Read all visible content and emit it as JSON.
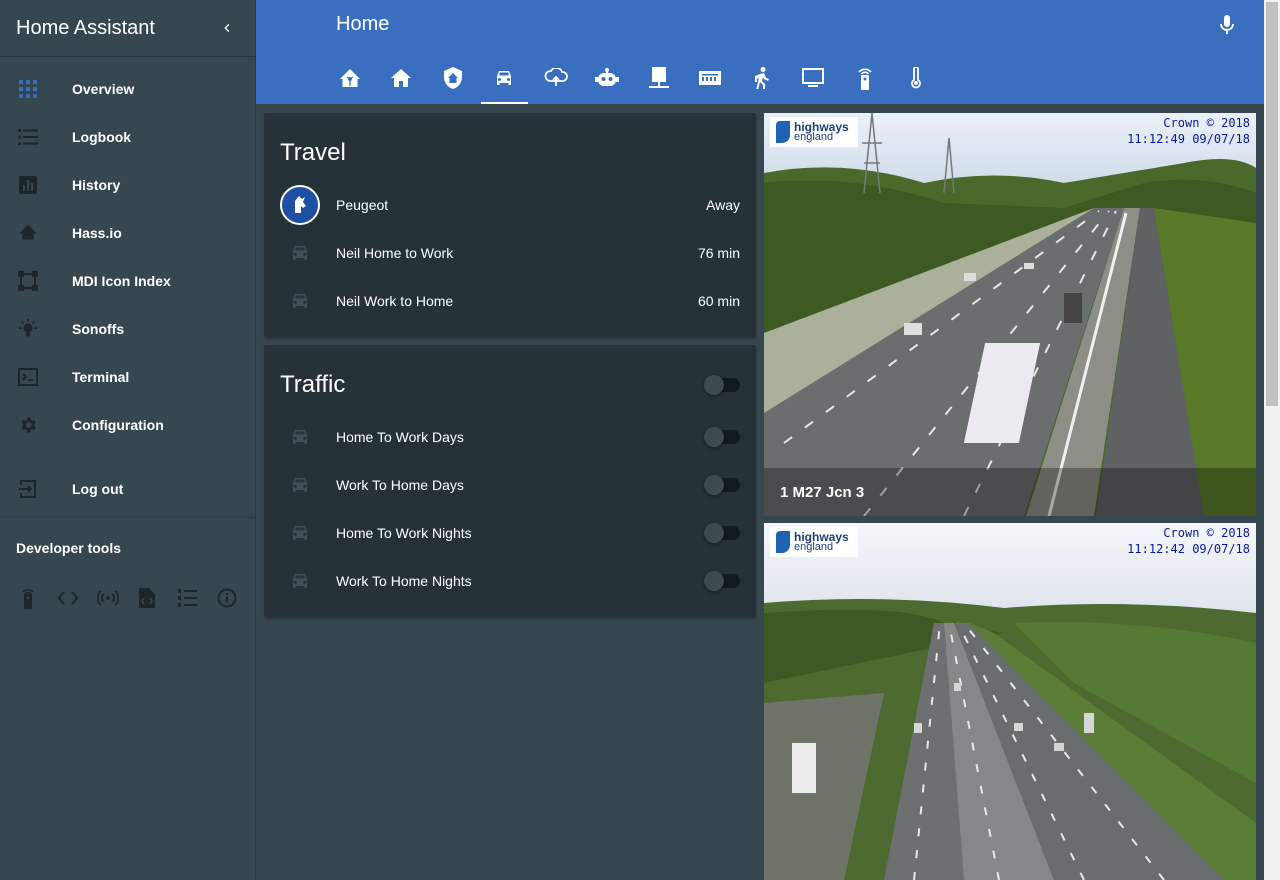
{
  "app": {
    "title": "Home Assistant"
  },
  "sidebar": {
    "items": [
      {
        "label": "Overview",
        "icon": "view-dashboard-icon"
      },
      {
        "label": "Logbook",
        "icon": "format-list-bulleted-icon"
      },
      {
        "label": "History",
        "icon": "chart-box-icon"
      },
      {
        "label": "Hass.io",
        "icon": "home-assistant-icon"
      },
      {
        "label": "MDI Icon Index",
        "icon": "vector-square-icon"
      },
      {
        "label": "Sonoffs",
        "icon": "lightbulb-on-icon"
      },
      {
        "label": "Terminal",
        "icon": "console-icon"
      },
      {
        "label": "Configuration",
        "icon": "settings-icon"
      }
    ],
    "logout": "Log out",
    "dev_tools_title": "Developer tools",
    "dev_tools": [
      "remote-icon",
      "code-tags-icon",
      "access-point-icon",
      "file-xml-icon",
      "format-list-numbers-icon",
      "information-outline-icon"
    ]
  },
  "header": {
    "title": "Home",
    "tabs": [
      "home-assistant-icon",
      "home-icon",
      "shield-home-icon",
      "car-icon",
      "weather-icon",
      "robot-icon",
      "desk-icon",
      "router-icon",
      "walk-icon",
      "monitor-icon",
      "remote-icon",
      "thermometer-icon"
    ],
    "active_tab": 3
  },
  "travel": {
    "title": "Travel",
    "rows": [
      {
        "name": "Peugeot",
        "value": "Away"
      },
      {
        "name": "Neil Home to Work",
        "value": "76 min"
      },
      {
        "name": "Neil Work to Home",
        "value": "60 min"
      }
    ]
  },
  "traffic": {
    "title": "Traffic",
    "rows": [
      {
        "name": "Home To Work Days"
      },
      {
        "name": "Work To Home Days"
      },
      {
        "name": "Home To Work Nights"
      },
      {
        "name": "Work To Home Nights"
      }
    ]
  },
  "cameras": [
    {
      "caption": "1 M27 Jcn 3",
      "stamp_line1": "Crown © 2018",
      "stamp_line2": "11:12:49 09/07/18",
      "logo_name": "highways",
      "logo_sub": "england"
    },
    {
      "caption": "",
      "stamp_line1": "Crown © 2018",
      "stamp_line2": "11:12:42 09/07/18",
      "logo_name": "highways",
      "logo_sub": "england"
    }
  ],
  "colors": {
    "header": "#3a6fc0",
    "sidebar": "#37474f",
    "card": "#263238",
    "accent_icon": "#3a6fc0"
  }
}
